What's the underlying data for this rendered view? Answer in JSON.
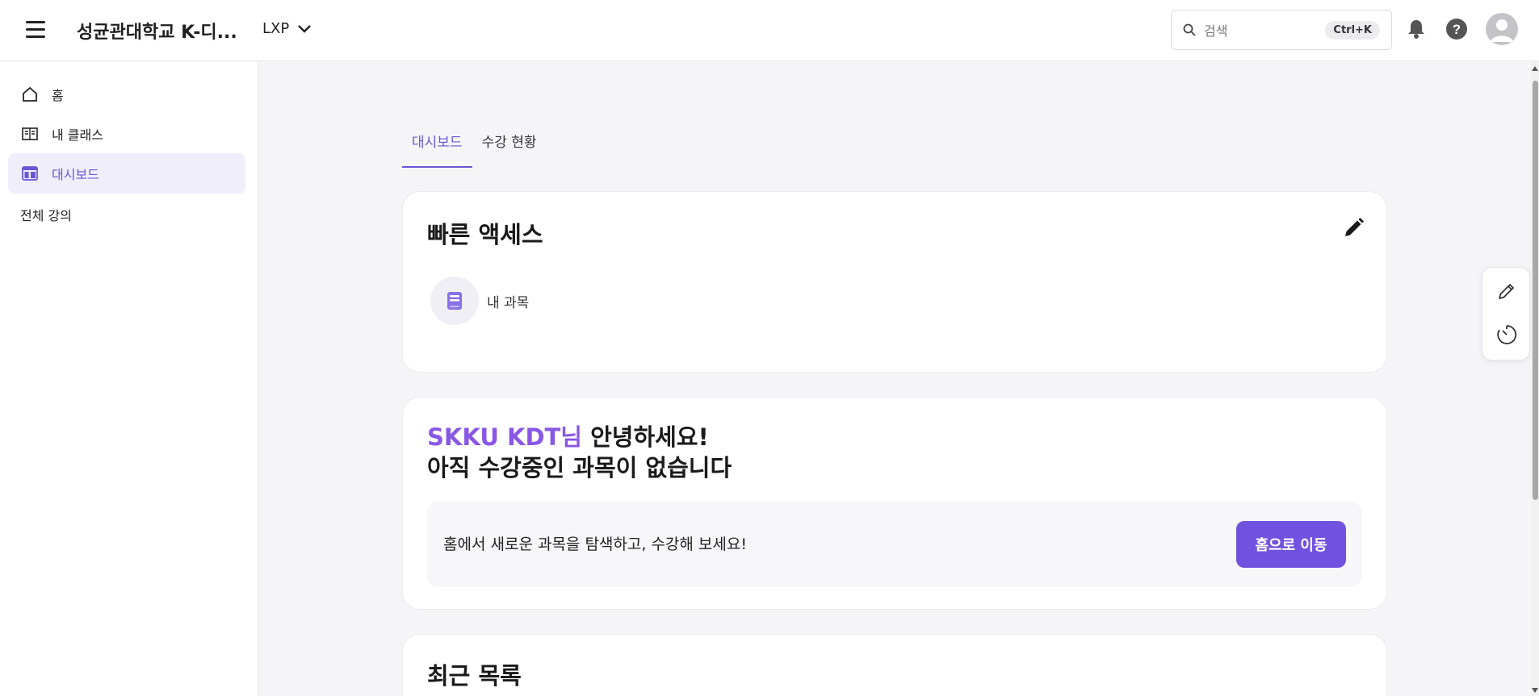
{
  "header": {
    "site_title": "성균관대학교 K-디...",
    "product": "LXP",
    "search_placeholder": "검색",
    "search_shortcut": "Ctrl+K"
  },
  "sidebar": {
    "items": [
      {
        "label": "홈",
        "icon": "home-icon"
      },
      {
        "label": "내 클래스",
        "icon": "book-icon"
      },
      {
        "label": "대시보드",
        "icon": "dashboard-icon",
        "active": true
      }
    ],
    "all_courses": "전체 강의"
  },
  "tabs": [
    {
      "label": "대시보드",
      "active": true
    },
    {
      "label": "수강 현황"
    }
  ],
  "quick_access": {
    "title": "빠른 액세스",
    "items": [
      {
        "label": "내 과목",
        "icon": "course-book-icon"
      }
    ]
  },
  "greeting": {
    "name": "SKKU KDT님",
    "hello": " 안녕하세요!",
    "line2": "아직 수강중인 과목이 없습니다",
    "prompt": "홈에서 새로운 과목을 탐색하고, 수강해 보세요!",
    "button": "홈으로 이동"
  },
  "recent": {
    "title": "최근 목록"
  },
  "colors": {
    "accent": "#7152e0",
    "highlight": "#8957e5",
    "active_bg": "#f1eefc"
  }
}
